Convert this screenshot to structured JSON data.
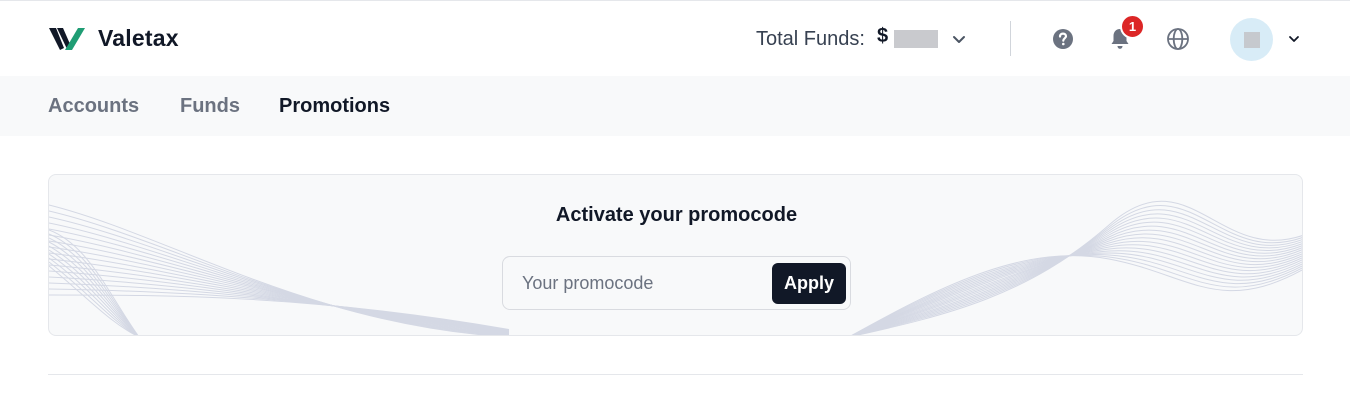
{
  "header": {
    "brand": "Valetax",
    "funds_label": "Total Funds:",
    "funds_currency": "$",
    "notification_count": "1"
  },
  "nav": {
    "items": [
      {
        "label": "Accounts"
      },
      {
        "label": "Funds"
      },
      {
        "label": "Promotions",
        "active": true
      }
    ]
  },
  "promo": {
    "title": "Activate your promocode",
    "input_placeholder": "Your promocode",
    "input_value": "",
    "apply_label": "Apply"
  },
  "colors": {
    "brand_dark": "#111827",
    "brand_green": "#1f9d74",
    "badge_red": "#dc2626",
    "nav_bg": "#f8f9fa",
    "avatar_bg": "#d8ecf7"
  },
  "icons": {
    "logo": "valetax-logo-icon",
    "help": "help-circle-icon",
    "bell": "bell-icon",
    "globe": "globe-icon",
    "chevron": "chevron-down-icon"
  }
}
